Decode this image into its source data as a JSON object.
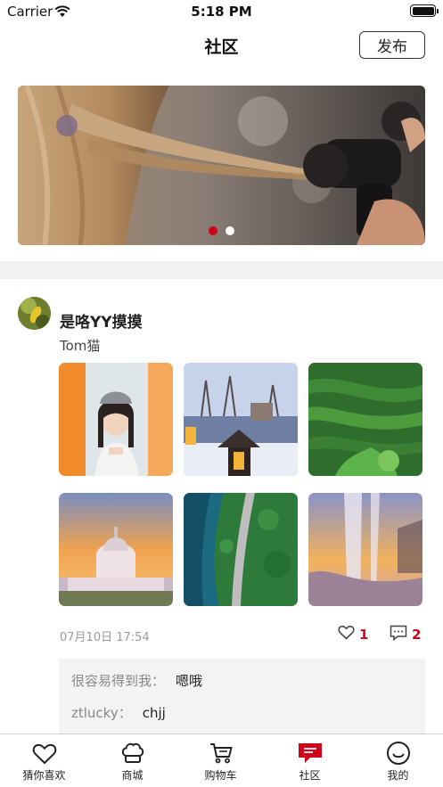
{
  "status_bar": {
    "carrier": "Carrier",
    "time": "5:18 PM"
  },
  "header": {
    "title": "社区",
    "publish_label": "发布"
  },
  "banner": {
    "slide_count": 2,
    "active_slide": 1,
    "accent_color": "#d0021b"
  },
  "post": {
    "username": "是咯YY摸摸",
    "text": "Tom猫",
    "photos": [
      "portrait-photo",
      "snow-village-photo",
      "green-terraces-photo",
      "cathedral-sunset-photo",
      "forest-road-photo",
      "waterfall-photo"
    ],
    "date": "07月10日 17:54",
    "likes": "1",
    "comments_count": "2",
    "comments": [
      {
        "name": "很容易得到我：",
        "text": "嗯哦"
      },
      {
        "name": "ztlucky：",
        "text": "chjj"
      }
    ]
  },
  "tab_bar": {
    "items": [
      {
        "label": "猜你喜欢",
        "icon": "heart-icon"
      },
      {
        "label": "商城",
        "icon": "chef-hat-icon"
      },
      {
        "label": "购物车",
        "icon": "cart-icon"
      },
      {
        "label": "社区",
        "icon": "chat-icon"
      },
      {
        "label": "我的",
        "icon": "smile-icon"
      }
    ],
    "active_index": 3,
    "active_color": "#d0021b"
  }
}
